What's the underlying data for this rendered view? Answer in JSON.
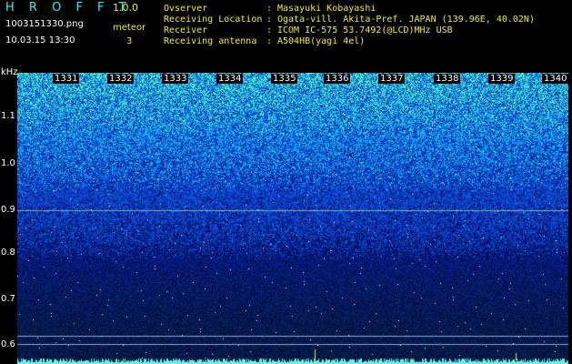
{
  "header": {
    "app_title": "H R O F F T",
    "version": "1.0.0",
    "filename": "1003151330.png",
    "meteor_label": "meteor",
    "datetime": "10.03.15 13:30",
    "meteor_count": "3"
  },
  "info": [
    {
      "label": "Ovserver",
      "value": "Masayuki Kobayashi"
    },
    {
      "label": "Receiving Location",
      "value": "Ogata-vill. Akita-Pref. JAPAN (139.96E, 40.02N)"
    },
    {
      "label": "Receiver",
      "value": "ICOM IC-575 53.7492(@LCD)MHz USB"
    },
    {
      "label": "Receiving antenna",
      "value": "A504HB(yagi 4el)"
    }
  ],
  "info_colon": ":",
  "spectrogram": {
    "y_unit": "kHz",
    "y_labels": [
      "1.1",
      "1.0",
      "0.9",
      "0.8",
      "0.7",
      "0.6"
    ],
    "time_ticks": [
      "1331",
      "1332",
      "1333",
      "1334",
      "1335",
      "1336",
      "1337",
      "1338",
      "1339",
      "1340"
    ],
    "colors": {
      "background": "#000000",
      "high": "#2ef0a0",
      "mid": "#1e4cff",
      "low": "#0a1a90",
      "trace": "#6af0e0"
    }
  }
}
